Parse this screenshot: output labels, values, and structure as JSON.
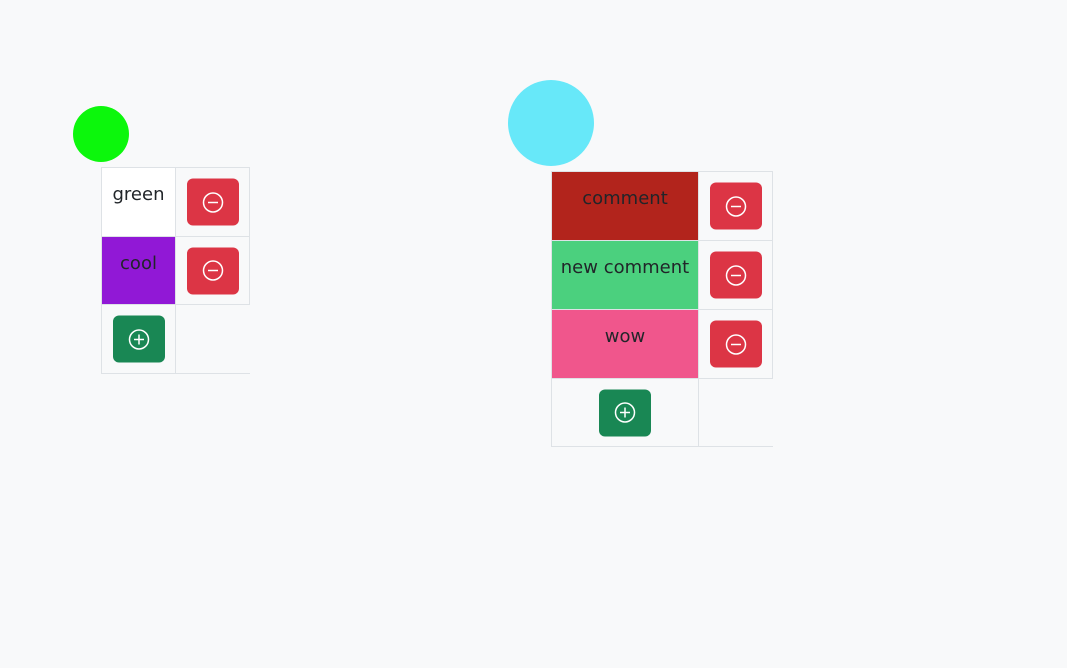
{
  "colors": {
    "remove_button": "#dc3545",
    "add_button": "#198754",
    "board_1_circle": "#0cf70c",
    "board_2_circle": "#67e8f9"
  },
  "icons": {
    "remove": "minus-circle-icon",
    "add": "plus-circle-icon"
  },
  "boards": [
    {
      "circle_color": "#0cf70c",
      "comments": [
        {
          "text": "green",
          "bg": "#ffffff"
        },
        {
          "text": "cool",
          "bg": "#9118d6"
        }
      ]
    },
    {
      "circle_color": "#67e8f9",
      "comments": [
        {
          "text": "comment",
          "bg": "#b2241c"
        },
        {
          "text": "new comment",
          "bg": "#4bd07e"
        },
        {
          "text": "wow",
          "bg": "#f0568c"
        }
      ]
    }
  ]
}
